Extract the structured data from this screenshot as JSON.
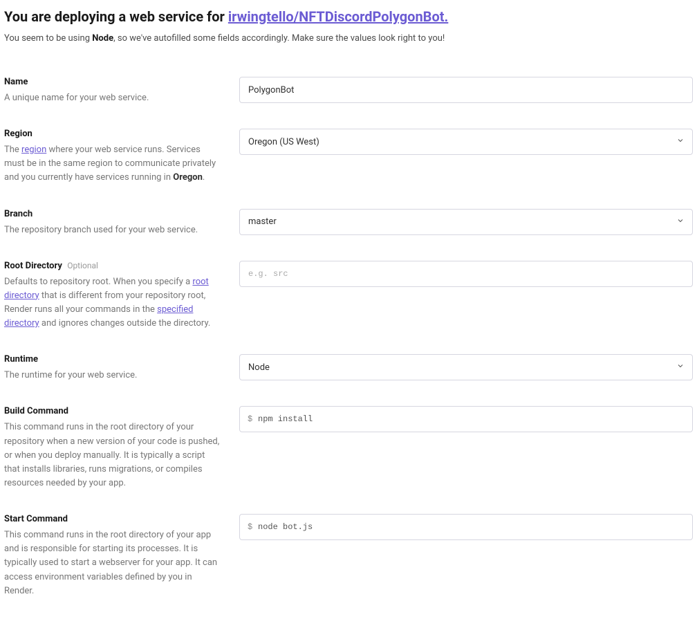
{
  "header": {
    "title_prefix": "You are deploying a web service for ",
    "repo": "irwingtello/NFTDiscordPolygonBot.",
    "subtitle_before": "You seem to be using ",
    "subtitle_bold": "Node",
    "subtitle_after": ", so we've autofilled some fields accordingly. Make sure the values look right to you!"
  },
  "fields": {
    "name": {
      "label": "Name",
      "help": "A unique name for your web service.",
      "value": "PolygonBot"
    },
    "region": {
      "label": "Region",
      "help_before": "The ",
      "help_link": "region",
      "help_mid": " where your web service runs. Services must be in the same region to communicate privately and you currently have services running in ",
      "help_bold": "Oregon",
      "help_after": ".",
      "value": "Oregon (US West)"
    },
    "branch": {
      "label": "Branch",
      "help": "The repository branch used for your web service.",
      "value": "master"
    },
    "root_directory": {
      "label": "Root Directory",
      "optional": "Optional",
      "help_before": "Defaults to repository root. When you specify a ",
      "help_link1": "root directory",
      "help_mid": " that is different from your repository root, Render runs all your commands in the ",
      "help_link2": "specified directory",
      "help_after": " and ignores changes outside the directory.",
      "placeholder": "e.g. src",
      "value": ""
    },
    "runtime": {
      "label": "Runtime",
      "help": "The runtime for your web service.",
      "value": "Node"
    },
    "build_command": {
      "label": "Build Command",
      "help": "This command runs in the root directory of your repository when a new version of your code is pushed, or when you deploy manually. It is typically a script that installs libraries, runs migrations, or compiles resources needed by your app.",
      "prefix": "$",
      "value": "npm install"
    },
    "start_command": {
      "label": "Start Command",
      "help": "This command runs in the root directory of your app and is responsible for starting its processes. It is typically used to start a webserver for your app. It can access environment variables defined by you in Render.",
      "prefix": "$",
      "value": "node bot.js"
    }
  }
}
